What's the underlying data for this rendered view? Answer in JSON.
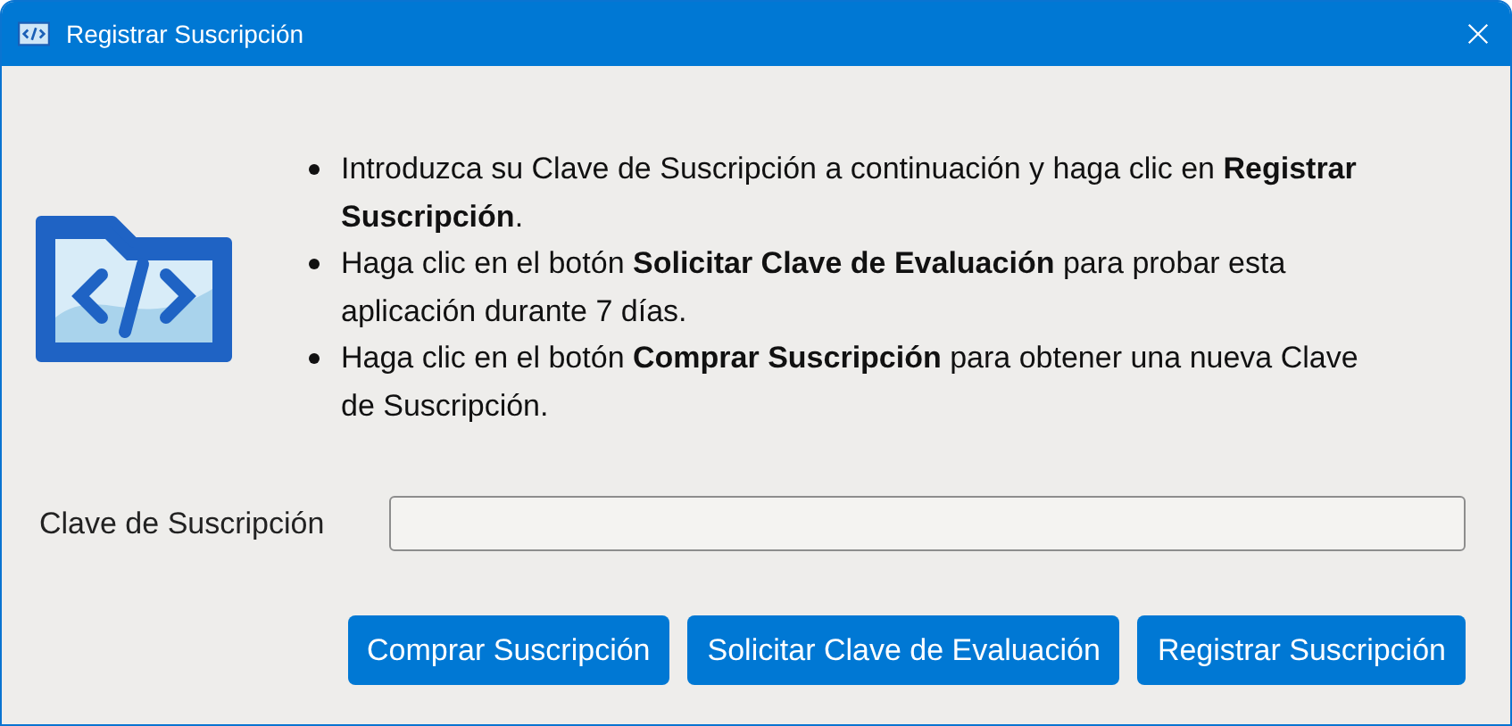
{
  "window": {
    "title": "Registrar Suscripción"
  },
  "instructions": [
    "Introduzca su Clave de Suscripción a continuación y haga clic en **Registrar Suscripción**.",
    "Haga clic en el botón **Solicitar Clave de Evaluación** para probar esta aplicación durante 7 días.",
    "Haga clic en el botón **Comprar Suscripción** para obtener una nueva Clave de Suscripción."
  ],
  "key_field": {
    "label": "Clave de Suscripción"
  },
  "buttons": [
    "Comprar Suscripción",
    "Solicitar Clave de Evaluación",
    "Registrar Suscripción"
  ]
}
